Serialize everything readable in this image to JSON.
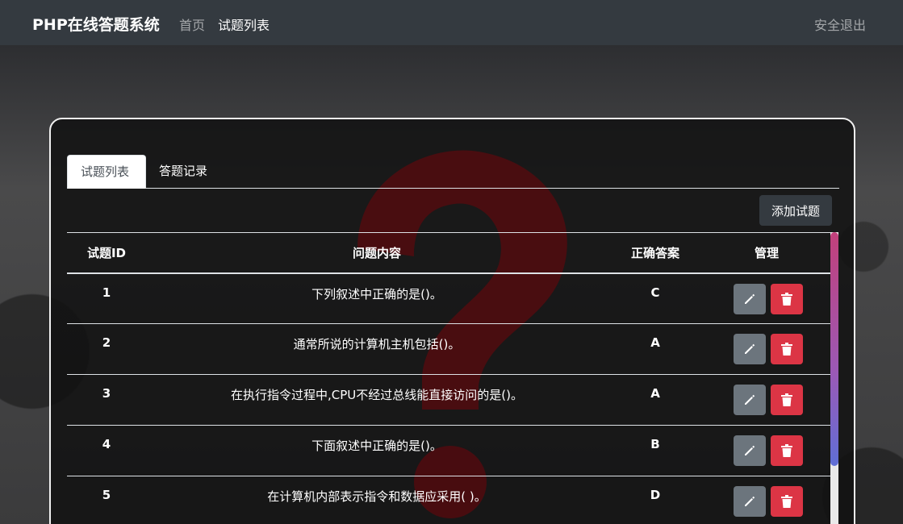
{
  "navbar": {
    "brand": "PHP在线答题系统",
    "home": "首页",
    "questions": "试题列表",
    "logout": "安全退出"
  },
  "tabs": [
    {
      "label": "试题列表",
      "active": true
    },
    {
      "label": "答题记录",
      "active": false
    }
  ],
  "add_button": "添加试题",
  "table": {
    "headers": [
      "试题ID",
      "问题内容",
      "正确答案",
      "管理"
    ],
    "rows": [
      {
        "id": "1",
        "question": "下列叙述中正确的是()。",
        "answer": "C"
      },
      {
        "id": "2",
        "question": "通常所说的计算机主机包括()。",
        "answer": "A"
      },
      {
        "id": "3",
        "question": "在执行指令过程中,CPU不经过总线能直接访问的是()。",
        "answer": "A"
      },
      {
        "id": "4",
        "question": "下面叙述中正确的是()。",
        "answer": "B"
      },
      {
        "id": "5",
        "question": "在计算机内部表示指令和数据应采用( )。",
        "answer": "D"
      }
    ]
  },
  "icons": {
    "edit": "pencil-icon",
    "delete": "trash-icon"
  },
  "colors": {
    "navbar": "#343a40",
    "edit_button": "#6c757d",
    "delete_button": "#dc3545"
  }
}
